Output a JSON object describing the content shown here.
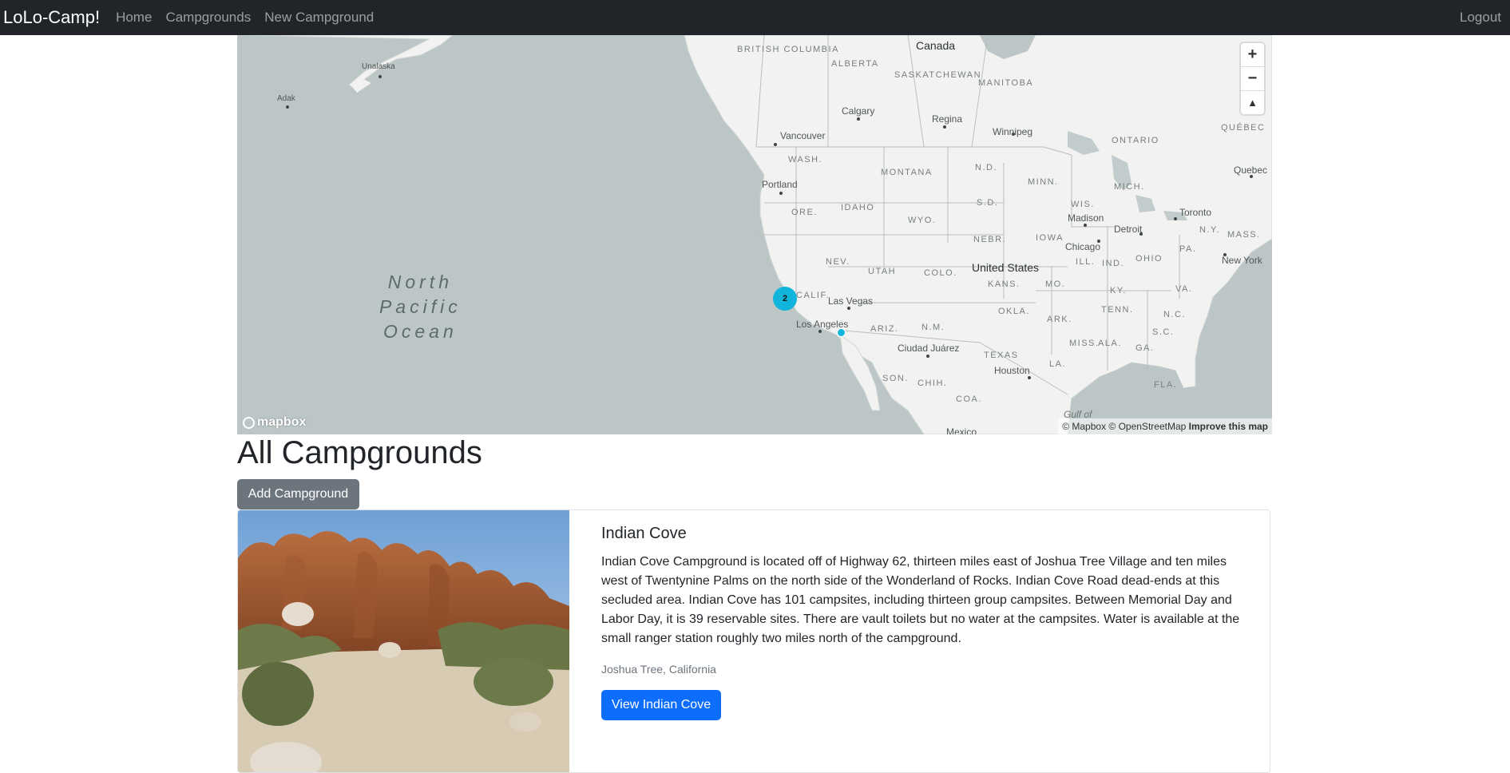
{
  "navbar": {
    "brand": "LoLo-Camp!",
    "links": [
      "Home",
      "Campgrounds",
      "New Campground"
    ],
    "logout": "Logout"
  },
  "map": {
    "ocean_label": [
      "North",
      "Pacific",
      "Ocean"
    ],
    "country_labels": [
      "Canada",
      "United States"
    ],
    "region_labels": [
      "BRITISH COLUMBIA",
      "ALBERTA",
      "SASKATCHEWAN",
      "MANITOBA",
      "ONTARIO",
      "QUÉBEC",
      "WASH.",
      "MONTANA",
      "N.D.",
      "MINN.",
      "ORE.",
      "IDAHO",
      "S.D.",
      "WIS.",
      "MICH.",
      "WYO.",
      "NEBR.",
      "IOWA",
      "N.Y.",
      "MASS.",
      "NEV.",
      "UTAH",
      "COLO.",
      "KANS.",
      "MO.",
      "ILL.",
      "IND.",
      "OHIO",
      "PA.",
      "CALIF.",
      "ARIZ.",
      "N.M.",
      "OKLA.",
      "ARK.",
      "TENN.",
      "KY.",
      "VA.",
      "N.C.",
      "S.C.",
      "TEXAS",
      "MISS.",
      "ALA.",
      "GA.",
      "LA.",
      "FLA.",
      "SON.",
      "CHIH.",
      "COA.",
      "Gulf of"
    ],
    "city_labels": [
      "Unalaska",
      "Adak",
      "Calgary",
      "Regina",
      "Winnipeg",
      "Vancouver",
      "Portland",
      "Quebec",
      "Toronto",
      "Madison",
      "Detroit",
      "Chicago",
      "New York",
      "Las Vegas",
      "Los Angeles",
      "Ciudad Juárez",
      "Houston",
      "Mexico"
    ],
    "cluster_count": "2",
    "zoom_in": "+",
    "zoom_out": "−",
    "compass": "▲",
    "logo_text": "mapbox",
    "attribution": "© Mapbox © OpenStreetMap",
    "improve": "Improve this map",
    "colors": {
      "water": "#bcc6c6",
      "land": "#f2f2f0",
      "cluster": "#11b4da"
    }
  },
  "page": {
    "title": "All Campgrounds",
    "add_button": "Add Campground"
  },
  "campgrounds": [
    {
      "title": "Indian Cove",
      "description": "Indian Cove Campground is located off of Highway 62, thirteen miles east of Joshua Tree Village and ten miles west of Twentynine Palms on the north side of the Wonderland of Rocks. Indian Cove Road dead-ends at this secluded area. Indian Cove has 101 campsites, including thirteen group campsites. Between Memorial Day and Labor Day, it is 39 reservable sites. There are vault toilets but no water at the campsites. Water is available at the small ranger station roughly two miles north of the campground.",
      "location": "Joshua Tree, California",
      "button": "View Indian Cove"
    }
  ]
}
